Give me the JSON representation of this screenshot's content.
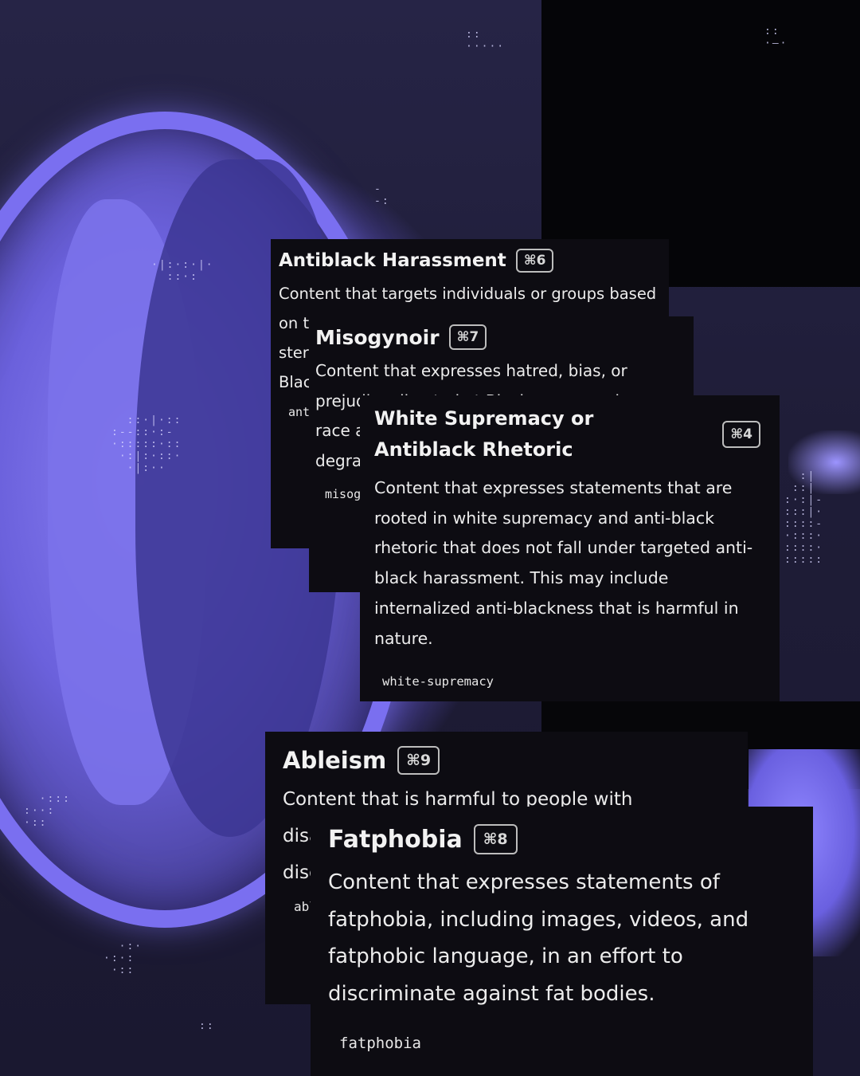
{
  "cards": [
    {
      "title": "Antiblack Harassment",
      "shortcut": "⌘6",
      "description": "Content that targets individuals or groups based on their race, using derogatory language, stereotypes, or content aimed at degrading Black people.",
      "tag": "antiblack-harassment"
    },
    {
      "title": "Misogynoir",
      "shortcut": "⌘7",
      "description": "Content that expresses hatred, bias, or prejudice directed at Black women, where race and gender intersect to objectify or degrade Black women.",
      "tag": "misogynoir"
    },
    {
      "title": "White Supremacy or Antiblack Rhetoric",
      "shortcut": "⌘4",
      "description": "Content that expresses statements that are rooted in white supremacy and anti-black rhetoric that does not fall under targeted anti-black harassment. This may include internalized anti-blackness that is harmful in nature.",
      "tag": "white-supremacy"
    },
    {
      "title": "Ableism",
      "shortcut": "⌘9",
      "description": "Content that is harmful to people with disabilities, including derogatory language and discrimination against people with disabilities.",
      "tag": "ableism"
    },
    {
      "title": "Fatphobia",
      "shortcut": "⌘8",
      "description": "Content that expresses statements of fatphobia, including images, videos, and fatphobic language, in an effort to discriminate against fat bodies.",
      "tag": "fatphobia"
    }
  ],
  "colors": {
    "card_background": "#0d0c12",
    "accent_purple": "#7a6ff0",
    "text": "#f2f2f2"
  }
}
